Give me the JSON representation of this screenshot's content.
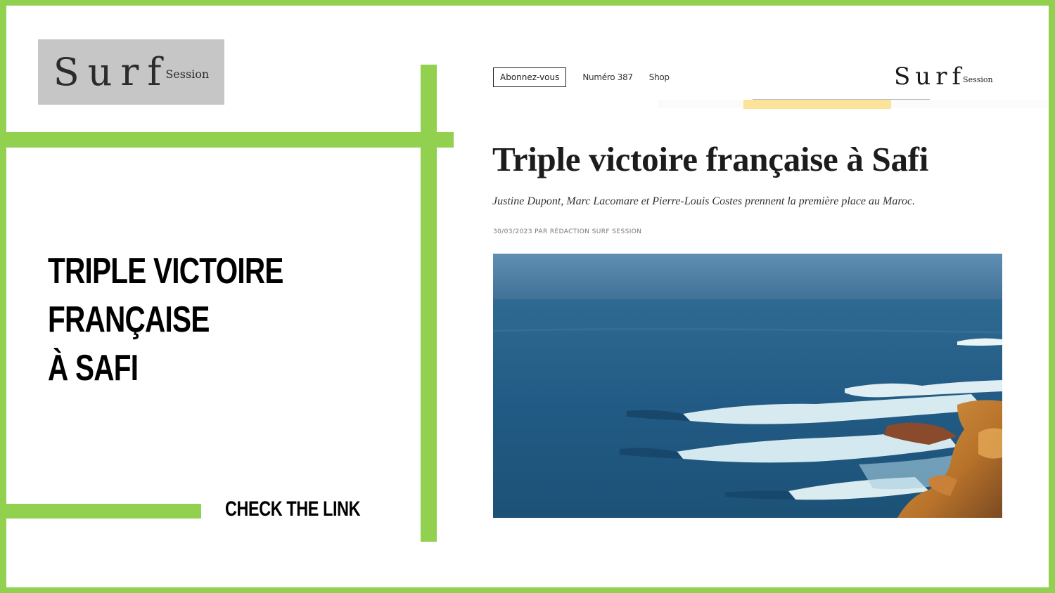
{
  "brand": {
    "logo_main": "Surf",
    "logo_sub": "Session"
  },
  "promo": {
    "headline_lines": [
      "TRIPLE VICTOIRE",
      "FRANÇAISE",
      "À SAFI"
    ],
    "cta": "CHECK THE LINK"
  },
  "site": {
    "nav": {
      "subscribe": "Abonnez-vous",
      "issue": "Numéro 387",
      "shop": "Shop"
    },
    "logo_main": "Surf",
    "logo_sub": "Session"
  },
  "article": {
    "title": "Triple victoire française à Safi",
    "subtitle": "Justine Dupont, Marc Lacomare et Pierre-Louis Costes prennent la première place au Maroc.",
    "meta": "30/03/2023 PAR RÉDACTION SURF SESSION"
  },
  "colors": {
    "accent": "#92d050",
    "logo_box": "#c6c6c6"
  }
}
